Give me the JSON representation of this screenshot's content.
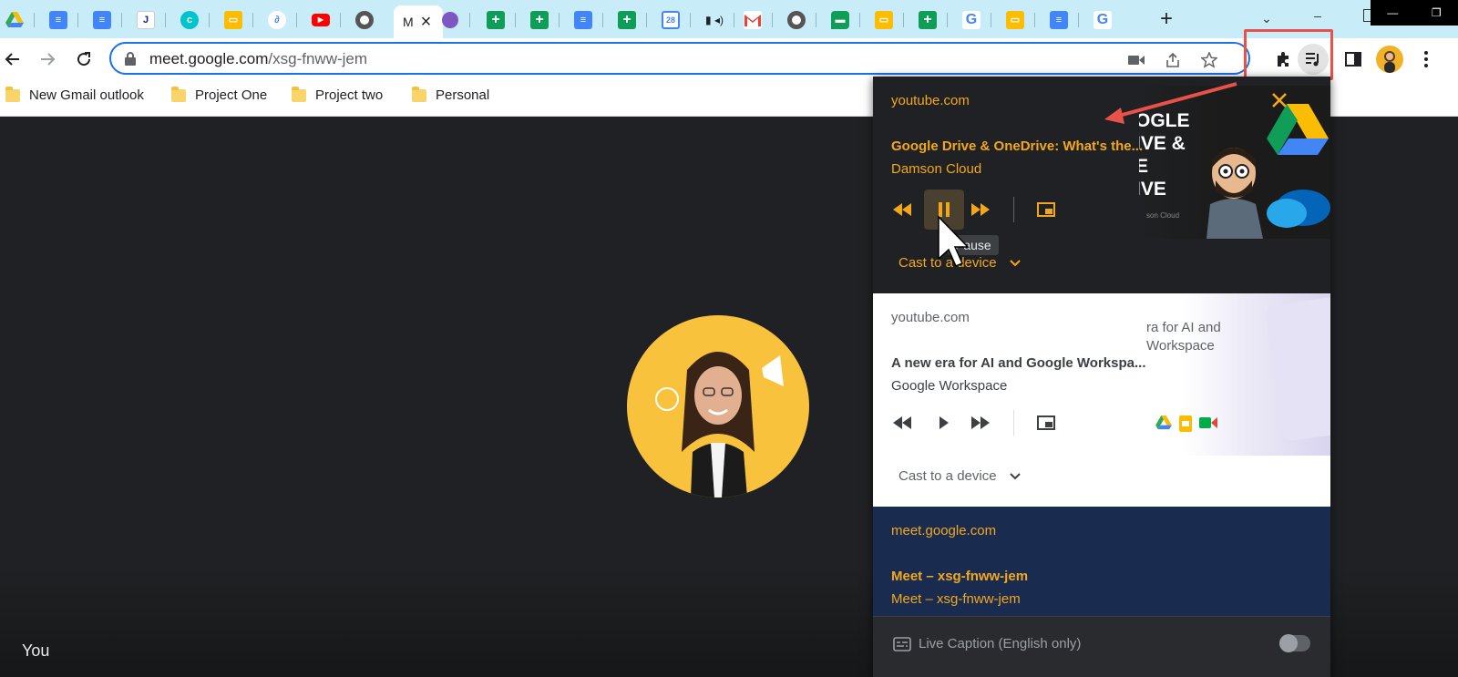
{
  "tabs": {
    "active_title": "M",
    "icons": [
      "google-drive",
      "google-docs",
      "google-docs",
      "j-app",
      "canva",
      "google-slides",
      "multi-app",
      "youtube",
      "chrome",
      "meet",
      "tor",
      "google-sheets",
      "google-sheets",
      "google-docs",
      "google-sheets",
      "google-calendar",
      "audio-tab",
      "gmail",
      "chrome",
      "google-chat",
      "google-slides",
      "google-sheets",
      "google",
      "google-slides",
      "google-docs",
      "google"
    ],
    "calendar_day": "28",
    "j_letter": "J",
    "close_glyph": "×",
    "new_tab_glyph": "+"
  },
  "toolbar": {
    "url_host": "meet.google.com",
    "url_path": "/xsg-fnww-jem"
  },
  "bookmarks": [
    {
      "label": "New Gmail outlook"
    },
    {
      "label": "Project One"
    },
    {
      "label": "Project two"
    },
    {
      "label": "Personal"
    }
  ],
  "media_hub": {
    "card1": {
      "origin": "youtube.com",
      "title": "Google Drive & OneDrive: What's the...",
      "artist": "Damson Cloud",
      "cast_label": "Cast to a device",
      "tooltip": "Pause",
      "thumb_text": [
        "OGLE",
        "IVE &",
        "E",
        "IVE"
      ],
      "thumb_caption": "son Cloud"
    },
    "card2": {
      "origin": "youtube.com",
      "title": "A new era for AI and Google Workspa...",
      "artist": "Google Workspace",
      "cast_label": "Cast to a device",
      "thumb_text": [
        "ra for AI and",
        "Workspace"
      ]
    },
    "card3": {
      "origin": "meet.google.com",
      "title": "Meet – xsg-fnww-jem",
      "artist": "Meet – xsg-fnww-jem"
    },
    "live_caption": "Live Caption (English only)"
  },
  "meet": {
    "self_label": "You"
  },
  "colors": {
    "accent_orange": "#f2a81d",
    "highlight_red": "#e8524a",
    "omnibox_blue": "#1a73e8",
    "tabstrip": "#c8ecf8"
  }
}
